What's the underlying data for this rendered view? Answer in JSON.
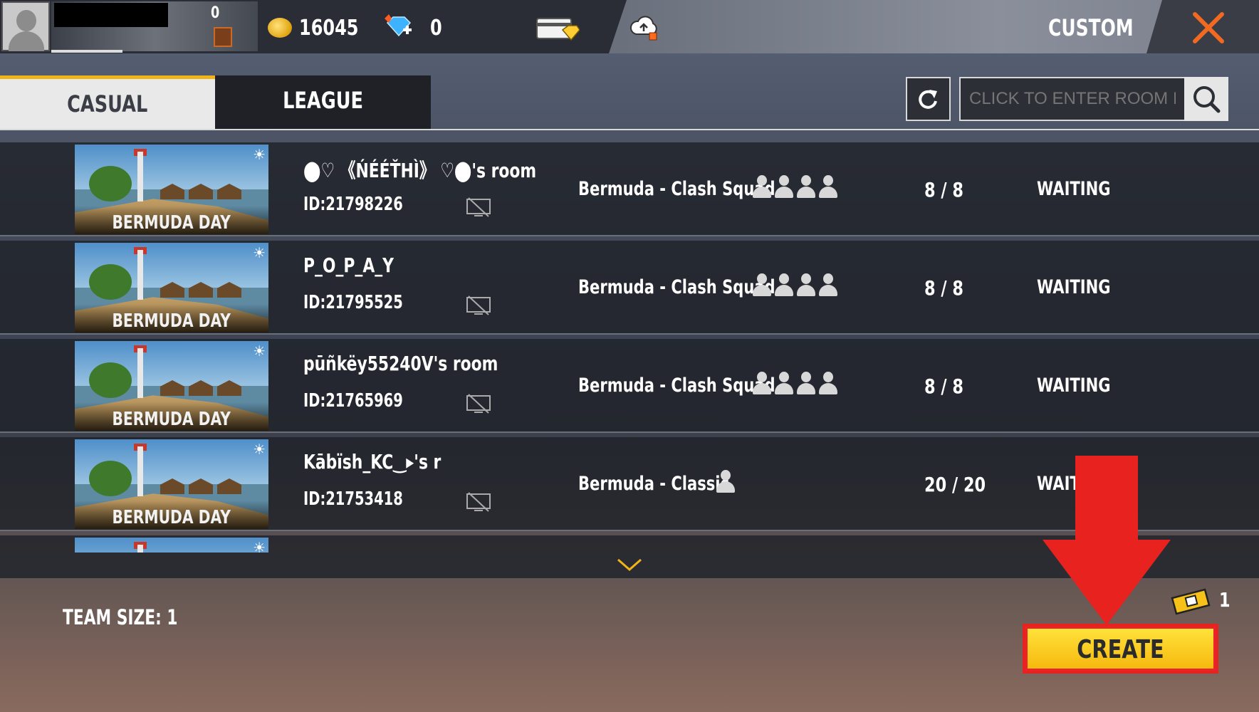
{
  "topbar": {
    "bp_count": "0",
    "coins": "16045",
    "diamonds": "0",
    "title": "CUSTOM"
  },
  "tabs": [
    {
      "label": "CASUAL",
      "active": true
    },
    {
      "label": "LEAGUE",
      "active": false
    }
  ],
  "search": {
    "placeholder": "CLICK TO ENTER ROOM ID"
  },
  "rooms": [
    {
      "map": "BERMUDA DAY",
      "name": "⬤♡ 《ŃÉÉŤHÌ》 ♡⬤'s room",
      "id": "ID:21798226",
      "mode": "Bermuda - Clash Squad",
      "team_size": 4,
      "count": "8 / 8",
      "status": "WAITING"
    },
    {
      "map": "BERMUDA DAY",
      "name": "P_O_P_A_Y",
      "id": "ID:21795525",
      "mode": "Bermuda - Clash Squad",
      "team_size": 4,
      "count": "8 / 8",
      "status": "WAITING"
    },
    {
      "map": "BERMUDA DAY",
      "name": "pūñkëy55240V's room",
      "id": "ID:21765969",
      "mode": "Bermuda - Clash Squad",
      "team_size": 4,
      "count": "8 / 8",
      "status": "WAITING"
    },
    {
      "map": "BERMUDA DAY",
      "name": "Kābïsh_KC‿▸'s r",
      "id": "ID:21753418",
      "mode": "Bermuda - Classic",
      "team_size": 1,
      "count": "20 / 20",
      "status": "WAIT"
    }
  ],
  "footer": {
    "team_size": "TEAM SIZE: 1",
    "ticket_count": "1",
    "create_label": "CREATE"
  },
  "colors": {
    "accent_yellow": "#f0b319",
    "close_orange": "#f26a1f",
    "highlight_red": "#e8231f"
  },
  "icons": [
    "avatar-icon",
    "coin-icon",
    "diamond-icon",
    "card-icon",
    "cloud-icon",
    "close-icon",
    "refresh-icon",
    "search-icon",
    "spectate-icon",
    "person-icon",
    "chevron-down-icon",
    "ticket-icon"
  ]
}
